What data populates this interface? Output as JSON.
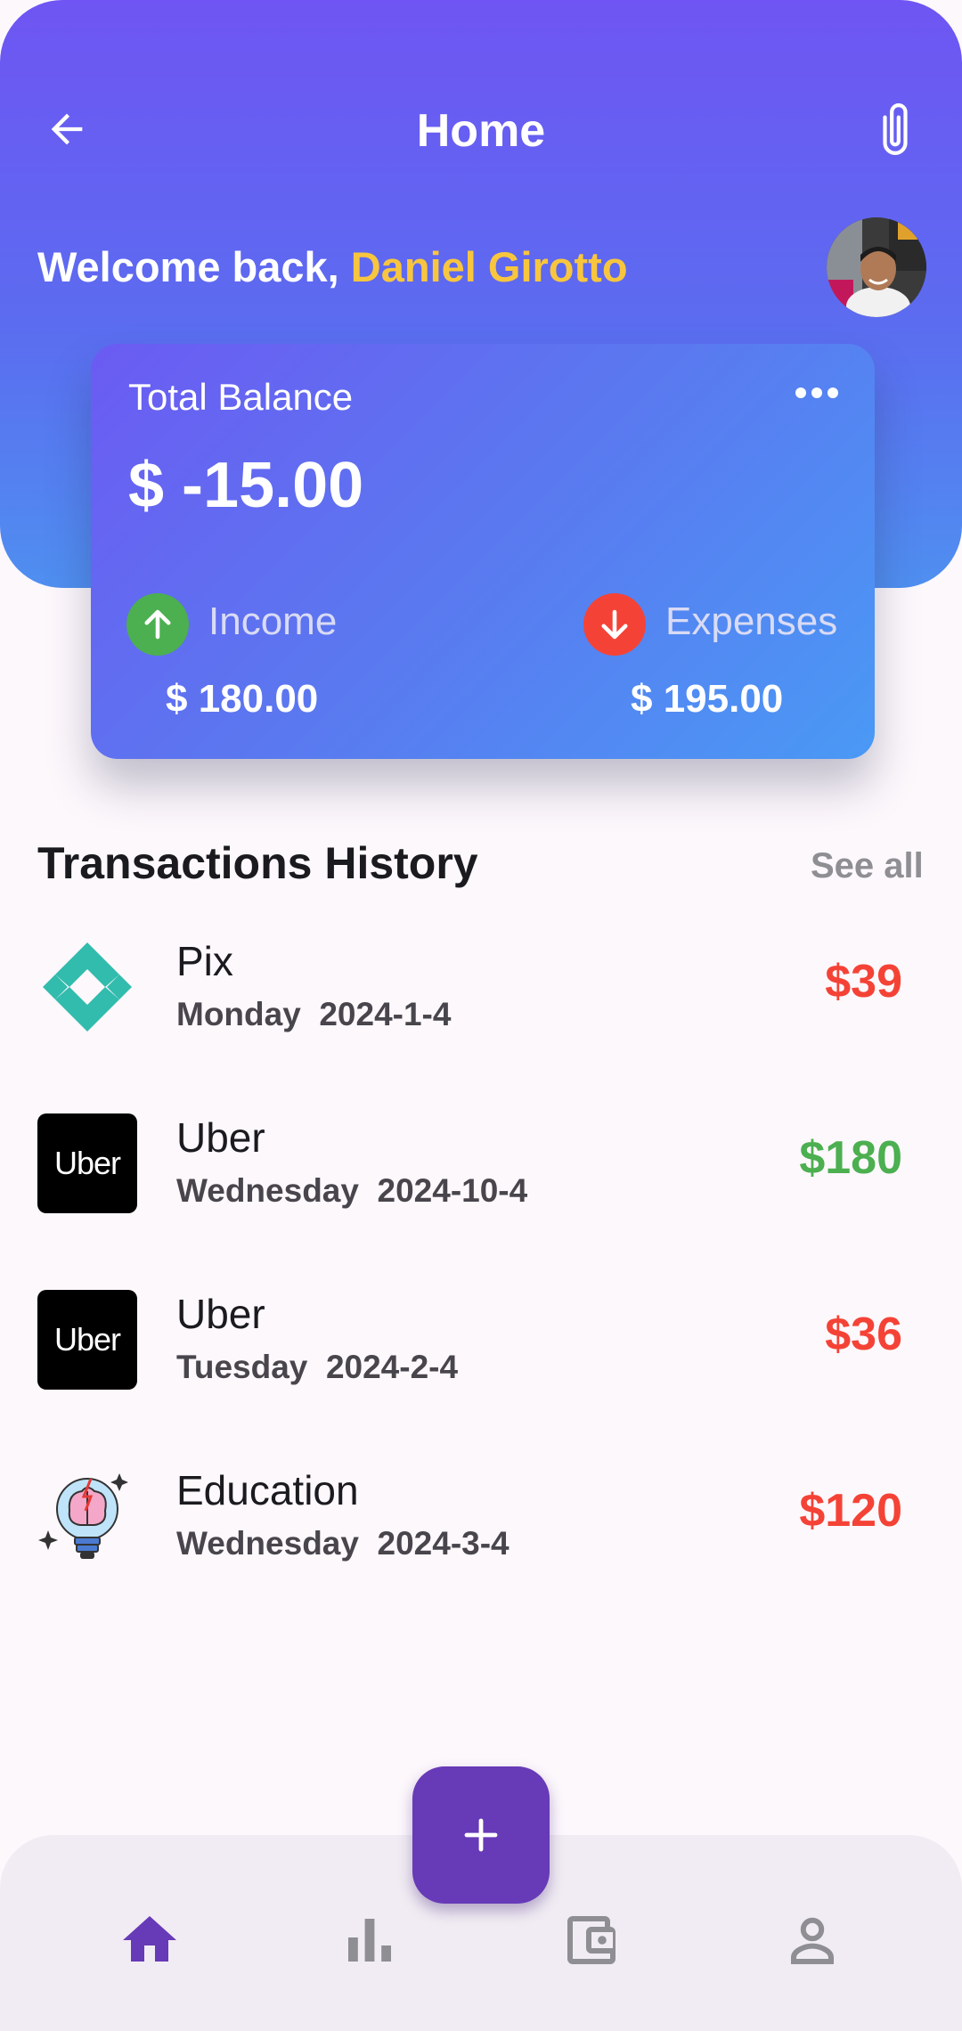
{
  "header": {
    "title": "Home",
    "welcome_prefix": "Welcome back, ",
    "user_name": "Daniel Girotto"
  },
  "balance_card": {
    "label": "Total Balance",
    "balance": "$ -15.00",
    "income_label": "Income",
    "income_value": "$ 180.00",
    "expenses_label": "Expenses",
    "expenses_value": "$ 195.00"
  },
  "transactions": {
    "title": "Transactions History",
    "see_all": "See all",
    "items": [
      {
        "name": "Pix",
        "day": "Monday",
        "date": "2024-1-4",
        "amount": "$39",
        "type": "expense"
      },
      {
        "name": "Uber",
        "day": "Wednesday",
        "date": "2024-10-4",
        "amount": "$180",
        "type": "income"
      },
      {
        "name": "Uber",
        "day": "Tuesday",
        "date": "2024-2-4",
        "amount": "$36",
        "type": "expense"
      },
      {
        "name": "Education",
        "day": "Wednesday",
        "date": "2024-3-4",
        "amount": "$120",
        "type": "expense"
      }
    ]
  },
  "logos": {
    "uber_text": "Uber"
  },
  "colors": {
    "primary": "#673ab7",
    "income": "#4caf50",
    "expense": "#f44336",
    "highlight": "#f8c63e"
  },
  "icons": {
    "back": "arrow-left-icon",
    "attach": "paperclip-icon",
    "more": "more-horizontal-icon",
    "income": "arrow-up-icon",
    "expense": "arrow-down-icon",
    "nav": [
      "home-icon",
      "bar-chart-icon",
      "wallet-icon",
      "person-icon"
    ],
    "fab": "plus-icon"
  }
}
